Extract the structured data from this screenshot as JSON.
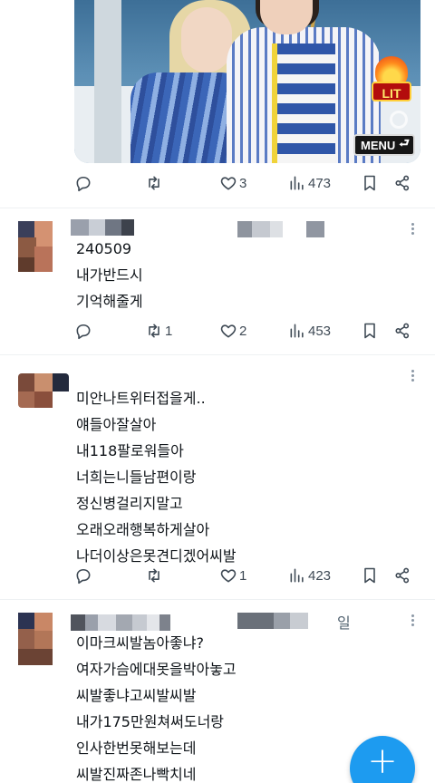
{
  "media": {
    "badge_text": "LIT",
    "menu_label": "MENU",
    "back_glyph": "⮐"
  },
  "tweets": [
    {
      "id": "top",
      "text_lines": [],
      "stats": {
        "reply": "",
        "retweet": "",
        "like": "3",
        "views": "473"
      }
    },
    {
      "id": "t1",
      "text_lines": [
        "240509",
        "내가반드시",
        "기억해줄게"
      ],
      "stats": {
        "reply": "",
        "retweet": "1",
        "like": "2",
        "views": "453"
      }
    },
    {
      "id": "t2",
      "text_lines": [
        "미안나트위터접을게..",
        "얘들아잘살아",
        "내118팔로워들아",
        "너희는니들남편이랑",
        "정신병걸리지말고",
        "오래오래행복하게살아",
        "나더이상은못견디겠어씨발"
      ],
      "stats": {
        "reply": "",
        "retweet": "",
        "like": "1",
        "views": "423"
      }
    },
    {
      "id": "t3",
      "side_text": "일",
      "text_lines": [
        "이마크씨발놈아좋냐?",
        "여자가슴에대못을박아놓고",
        "씨발좋냐고씨발씨발",
        "내가175만원쳐써도너랑",
        "인사한번못해보는데",
        "씨발진짜존나빡치네"
      ],
      "stats": {}
    }
  ],
  "icons": {
    "reply": "reply-icon",
    "retweet": "retweet-icon",
    "like": "heart-icon",
    "views": "views-icon",
    "bookmark": "bookmark-icon",
    "share": "share-icon",
    "more": "more-dots-icon",
    "compose": "plus-icon"
  },
  "colors": {
    "accent": "#1d9bf0",
    "icon_gray": "#3f4a55",
    "text": "#0f1419"
  }
}
